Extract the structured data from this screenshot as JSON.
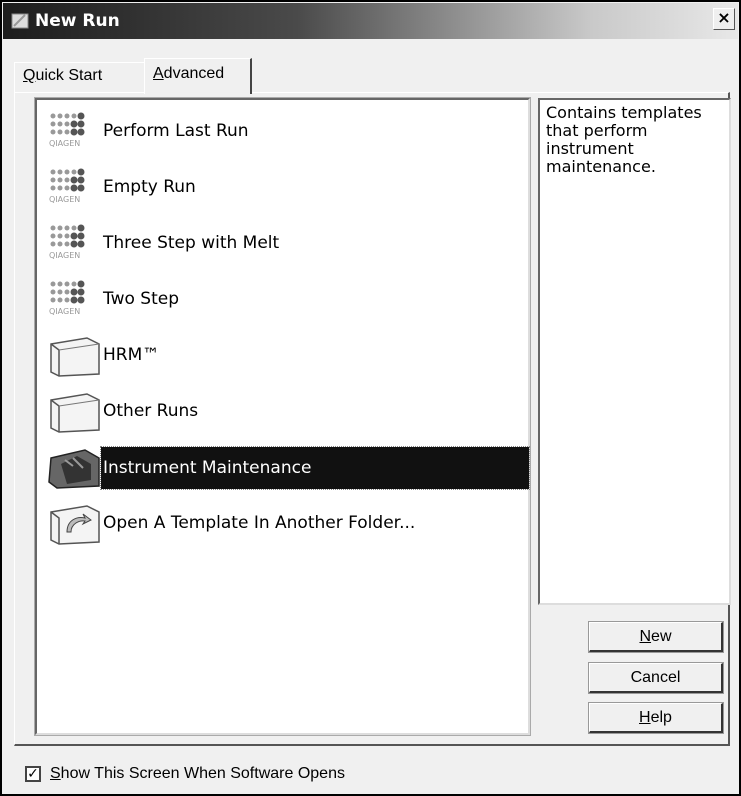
{
  "window": {
    "title": "New Run",
    "close_glyph": "×"
  },
  "tabs": [
    {
      "label_pre": "",
      "label_ul": "Q",
      "label_post": "uick Start",
      "active": false
    },
    {
      "label_pre": "",
      "label_ul": "A",
      "label_post": "dvanced",
      "active": true
    }
  ],
  "templates": [
    {
      "label": "Perform Last Run",
      "icon": "qiagen-template-icon",
      "icon_text": "QIAGEN"
    },
    {
      "label": "Empty Run",
      "icon": "qiagen-template-icon",
      "icon_text": "QIAGEN"
    },
    {
      "label": "Three Step with Melt",
      "icon": "qiagen-template-icon",
      "icon_text": "QIAGEN"
    },
    {
      "label": "Two Step",
      "icon": "qiagen-template-icon",
      "icon_text": "QIAGEN"
    },
    {
      "label": "HRM™",
      "icon": "folder-icon"
    },
    {
      "label": "Other Runs",
      "icon": "folder-icon"
    },
    {
      "label": "Instrument Maintenance",
      "icon": "maintenance-folder-icon",
      "selected": true
    },
    {
      "label": "Open A Template In Another Folder...",
      "icon": "open-folder-icon"
    }
  ],
  "description": "Contains templates that perform instrument maintenance.",
  "buttons": {
    "new": {
      "ul": "N",
      "rest": "ew"
    },
    "cancel": {
      "label": "Cancel"
    },
    "help": {
      "ul": "H",
      "rest": "elp"
    }
  },
  "show_on_open": {
    "checked": true,
    "check_glyph": "✓",
    "ul": "S",
    "rest": "how This Screen When Software Opens"
  }
}
